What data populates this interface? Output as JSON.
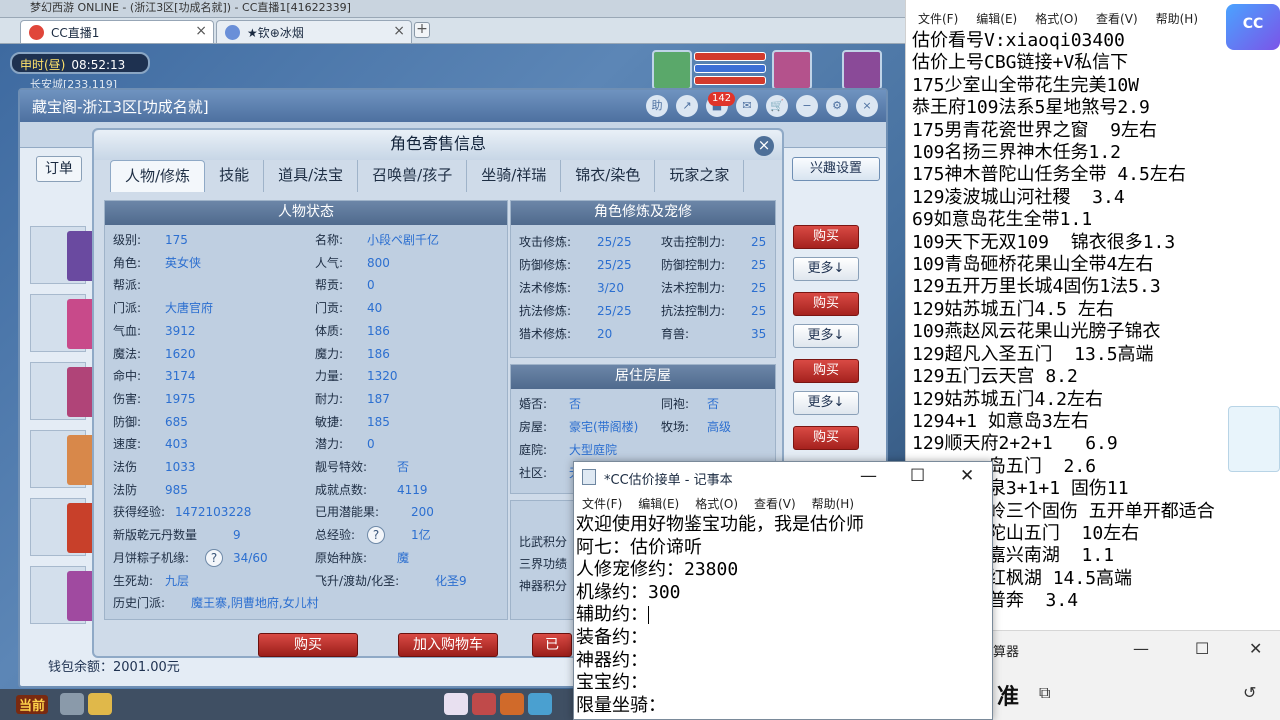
{
  "browser": {
    "window_title": "梦幻西游 ONLINE - (浙江3区[功成名就]) - CC直播1[41622339]",
    "tabs": [
      {
        "label": "CC直播1",
        "active": true
      },
      {
        "label": "★钦⊕冰烟",
        "active": false
      }
    ],
    "new_tab": "+"
  },
  "game": {
    "clock_period": "申时(昼)",
    "clock_time": "08:52:13",
    "location": "长安城[233,119]",
    "cbg": {
      "title": "藏宝阁-浙江3区[功成名就]",
      "help_label": "助",
      "cart_badge": "142",
      "order_label": "订单",
      "interest_btn": "兴趣设置",
      "side_buttons": {
        "buy": "购买",
        "more": "更多↓"
      },
      "wallet": "钱包余额：2001.00元"
    },
    "bottom_bar": {
      "front": "当前"
    }
  },
  "dialog": {
    "title": "角色寄售信息",
    "close": "×",
    "tabs": [
      "人物/修炼",
      "技能",
      "道具/法宝",
      "召唤兽/孩子",
      "坐骑/祥瑞",
      "锦衣/染色",
      "玩家之家"
    ],
    "status_title": "人物状态",
    "status_left": [
      {
        "k": "级别:",
        "v": "175"
      },
      {
        "k": "角色:",
        "v": "英女侠"
      },
      {
        "k": "帮派:",
        "v": ""
      },
      {
        "k": "门派:",
        "v": "大唐官府"
      },
      {
        "k": "气血:",
        "v": "3912"
      },
      {
        "k": "魔法:",
        "v": "1620"
      },
      {
        "k": "命中:",
        "v": "3174"
      },
      {
        "k": "伤害:",
        "v": "1975"
      },
      {
        "k": "防御:",
        "v": "685"
      },
      {
        "k": "速度:",
        "v": "403"
      },
      {
        "k": "法伤",
        "v": "1033"
      },
      {
        "k": "法防",
        "v": "985"
      },
      {
        "k": "获得经验:",
        "v": "1472103228"
      },
      {
        "k": "新版乾元丹数量",
        "v": "9"
      },
      {
        "k": "月饼粽子机缘:",
        "v": "34/60"
      },
      {
        "k": "生死劫:",
        "v": "九层"
      },
      {
        "k": "历史门派:",
        "v": "魔王寨,阴曹地府,女儿村"
      }
    ],
    "status_right": [
      {
        "k": "名称:",
        "v": "小段ペ剧千亿"
      },
      {
        "k": "人气:",
        "v": "800"
      },
      {
        "k": "帮贡:",
        "v": "0"
      },
      {
        "k": "门贡:",
        "v": "40"
      },
      {
        "k": "体质:",
        "v": "186"
      },
      {
        "k": "魔力:",
        "v": "186"
      },
      {
        "k": "力量:",
        "v": "1320"
      },
      {
        "k": "耐力:",
        "v": "187"
      },
      {
        "k": "敏捷:",
        "v": "185"
      },
      {
        "k": "潜力:",
        "v": "0"
      },
      {
        "k": "靓号特效:",
        "v": "否"
      },
      {
        "k": "成就点数:",
        "v": "4119"
      },
      {
        "k": "已用潜能果:",
        "v": "200"
      },
      {
        "k": "总经验:",
        "v": "1亿"
      },
      {
        "k": "原始种族:",
        "v": "魔"
      },
      {
        "k": "飞升/渡劫/化圣:",
        "v": "化圣9"
      }
    ],
    "cultivation_title": "角色修炼及宠修",
    "cultivation": [
      {
        "k1": "攻击修炼:",
        "v1": "25/25",
        "k2": "攻击控制力:",
        "v2": "25"
      },
      {
        "k1": "防御修炼:",
        "v1": "25/25",
        "k2": "防御控制力:",
        "v2": "25"
      },
      {
        "k1": "法术修炼:",
        "v1": "3/20",
        "k2": "法术控制力:",
        "v2": "25"
      },
      {
        "k1": "抗法修炼:",
        "v1": "25/25",
        "k2": "抗法控制力:",
        "v2": "25"
      },
      {
        "k1": "猎术修炼:",
        "v1": "20",
        "k2": "育兽:",
        "v2": "35"
      }
    ],
    "house_title": "居住房屋",
    "house": [
      {
        "k1": "婚否:",
        "v1": "否",
        "k2": "同袍:",
        "v2": "否"
      },
      {
        "k1": "房屋:",
        "v1": "豪宅(带阁楼)",
        "k2": "牧场:",
        "v2": "高级"
      },
      {
        "k1": "庭院:",
        "v1": "大型庭院",
        "k2": "",
        "v2": ""
      },
      {
        "k1": "社区:",
        "v1": "无",
        "k2": "",
        "v2": ""
      }
    ],
    "extra_labels": [
      "比武积分",
      "三界功绩",
      "神器积分"
    ],
    "buy_btn": "购买",
    "cart_btn": "加入购物车",
    "third_btn": "已"
  },
  "notepad_right": {
    "menu": [
      "文件(F)",
      "编辑(E)",
      "格式(O)",
      "查看(V)",
      "帮助(H)"
    ],
    "lines": [
      "估价看号V:xiaoqi03400",
      "估价上号CBG链接+V私信下",
      "175少室山全带花生完美10W",
      "恭王府109法系5星地煞号2.9",
      "175男青花瓷世界之窗  9左右",
      "109名扬三界神木任务1.2",
      "175神木普陀山任务全带 4.5左右",
      "129凌波城山河社稷  3.4",
      "69如意岛花生全带1.1",
      "109天下无双109  锦衣很多1.3",
      "109青岛砸桥花果山全带4左右",
      "129五开万里长城4固伤1法5.3",
      "129姑苏城五门4.5 左右",
      "109燕赵风云花果山光膀子锦衣",
      "129超凡入圣五门  13.5高端",
      "129五门云天宫 8.2",
      "129姑苏城五门4.2左右",
      "1294+1 如意岛3左右",
      "129顺天府2+2+1   6.9",
      "       岛五门  2.6",
      "       泉3+1+1 固伤11",
      "       岭三个固伤 五开单开都适合",
      "       陀山五门  10左右",
      "       嘉兴南湖  1.1",
      "       红枫湖 14.5高端",
      "       普奔  3.4"
    ]
  },
  "calculator": {
    "title_fragment": "算器",
    "mode": "准"
  },
  "notepad_popup": {
    "title": "*CC估价接单 - 记事本",
    "menu": [
      "文件(F)",
      "编辑(E)",
      "格式(O)",
      "查看(V)",
      "帮助(H)"
    ],
    "lines": [
      "欢迎使用好物鉴宝功能，我是估价师",
      "阿七：估价谛听",
      "人修宠修约：23800",
      "机缘约：300",
      "辅助约：",
      "装备约：",
      "神器约：",
      "宝宝约：",
      "限量坐骑："
    ]
  },
  "colors": {
    "panel_head": "#4f6a8d",
    "value_blue": "#2c6fd0",
    "buy_red": "#c0302a"
  }
}
